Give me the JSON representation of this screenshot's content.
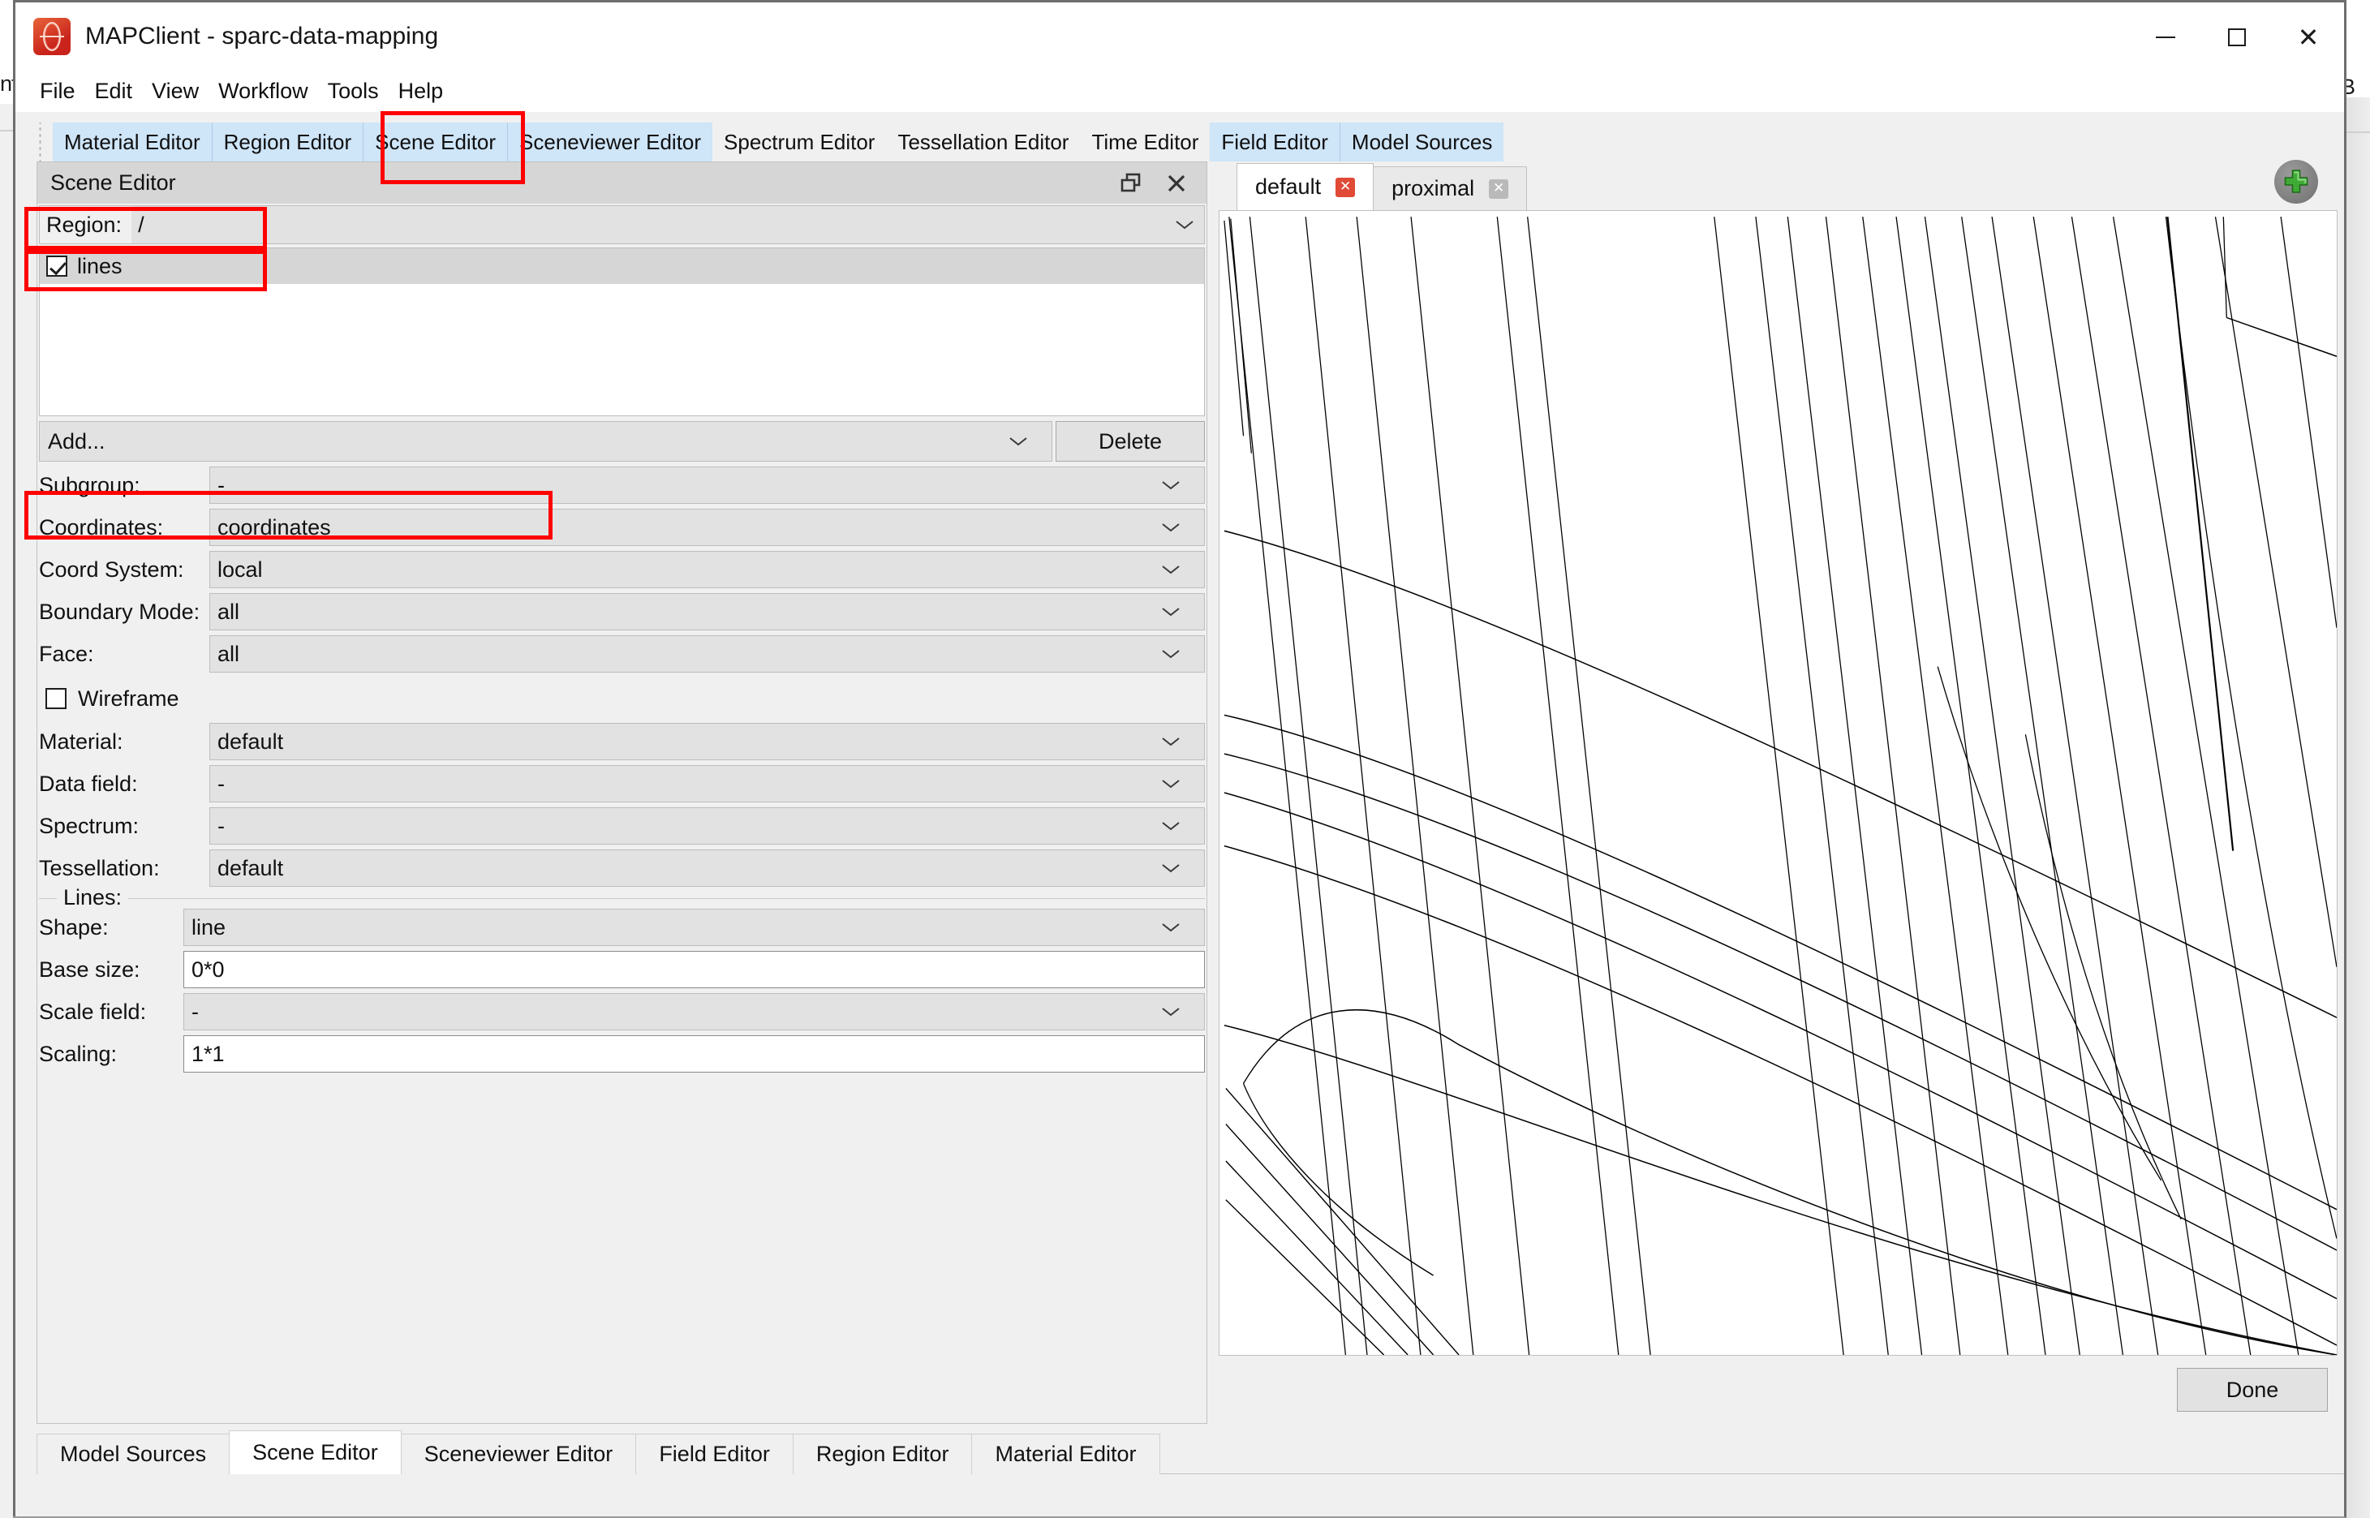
{
  "desktop": {
    "left_fragment": "nt",
    "right_fragment": "B"
  },
  "window": {
    "title": "MAPClient - sparc-data-mapping",
    "icon": "app-logo-icon",
    "controls": {
      "minimize": "minimize-icon",
      "maximize": "maximize-icon",
      "close": "close-icon"
    }
  },
  "menu": {
    "items": [
      "File",
      "Edit",
      "View",
      "Workflow",
      "Tools",
      "Help"
    ]
  },
  "top_tabs": [
    {
      "label": "Material Editor",
      "highlighted": true
    },
    {
      "label": "Region Editor",
      "highlighted": true
    },
    {
      "label": "Scene Editor",
      "highlighted": true
    },
    {
      "label": "Sceneviewer Editor",
      "highlighted": true
    },
    {
      "label": "Spectrum Editor",
      "highlighted": false
    },
    {
      "label": "Tessellation Editor",
      "highlighted": false
    },
    {
      "label": "Time Editor",
      "highlighted": false
    },
    {
      "label": "Field Editor",
      "highlighted": true
    },
    {
      "label": "Model Sources",
      "highlighted": true
    }
  ],
  "scene_editor": {
    "panel_title": "Scene Editor",
    "float_button": "float-icon",
    "close_button": "close-icon",
    "region": {
      "label": "Region:",
      "value": "/"
    },
    "graphics_list": [
      {
        "label": "lines",
        "checked": true,
        "selected": true
      }
    ],
    "add_combo": {
      "value": "Add...",
      "label": "Add..."
    },
    "delete_button": "Delete",
    "properties": [
      {
        "label": "Subgroup:",
        "value": "-",
        "type": "combo"
      },
      {
        "label": "Coordinates:",
        "value": "coordinates",
        "type": "combo"
      },
      {
        "label": "Coord System:",
        "value": "local",
        "type": "combo"
      },
      {
        "label": "Boundary Mode:",
        "value": "all",
        "type": "combo"
      },
      {
        "label": "Face:",
        "value": "all",
        "type": "combo"
      }
    ],
    "wireframe": {
      "label": "Wireframe",
      "checked": false
    },
    "properties2": [
      {
        "label": "Material:",
        "value": "default",
        "type": "combo"
      },
      {
        "label": "Data field:",
        "value": "-",
        "type": "combo"
      },
      {
        "label": "Spectrum:",
        "value": "-",
        "type": "combo"
      },
      {
        "label": "Tessellation:",
        "value": "default",
        "type": "combo"
      }
    ],
    "lines_group": {
      "title": "Lines:",
      "rows": [
        {
          "label": "Shape:",
          "value": "line",
          "type": "combo"
        },
        {
          "label": "Base size:",
          "value": "0*0",
          "type": "input"
        },
        {
          "label": "Scale field:",
          "value": "-",
          "type": "combo"
        },
        {
          "label": "Scaling:",
          "value": "1*1",
          "type": "input"
        }
      ]
    }
  },
  "viewer": {
    "tabs": [
      {
        "label": "default",
        "active": true,
        "close": "close-icon"
      },
      {
        "label": "proximal",
        "active": false,
        "close": "close-icon"
      }
    ],
    "add_view_button": "plus-icon",
    "done_button": "Done"
  },
  "bottom_tabs": [
    {
      "label": "Model Sources",
      "active": false
    },
    {
      "label": "Scene Editor",
      "active": true
    },
    {
      "label": "Sceneviewer Editor",
      "active": false
    },
    {
      "label": "Field Editor",
      "active": false
    },
    {
      "label": "Region Editor",
      "active": false
    },
    {
      "label": "Material Editor",
      "active": false
    }
  ],
  "colors": {
    "tab_highlight": "#cfe5f8",
    "annotation_red": "#ff0000",
    "window_bg": "#f0f0f0",
    "combo_bg": "#e2e2e2",
    "plus_green": "#3faa35"
  }
}
